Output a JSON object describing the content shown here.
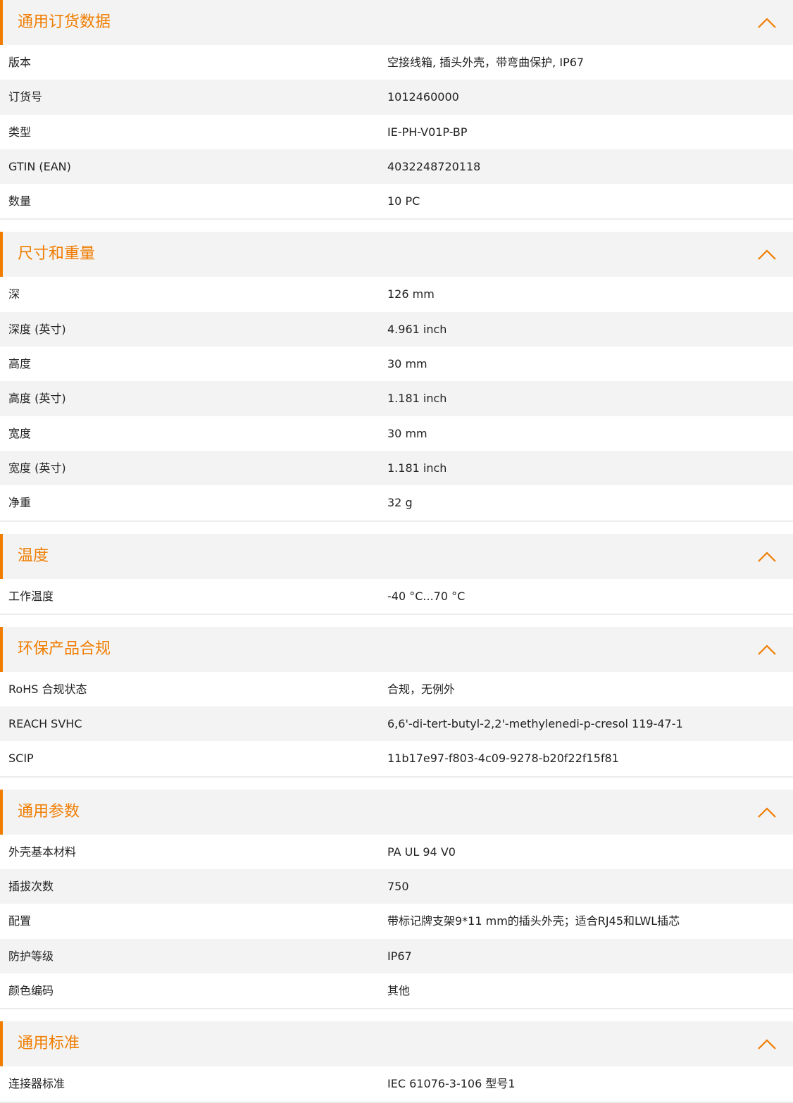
{
  "colors": {
    "accent": "#f07d00",
    "row_alt": "#f3f3f3",
    "header_bg": "#f3f3f3",
    "text": "#222222"
  },
  "icons": {
    "collapse": "chevron-up-icon"
  },
  "sections": [
    {
      "title": "通用订货数据",
      "rows": [
        {
          "label": "版本",
          "value": "空接线箱, 插头外壳，带弯曲保护, IP67"
        },
        {
          "label": "订货号",
          "value": "1012460000"
        },
        {
          "label": "类型",
          "value": "IE-PH-V01P-BP"
        },
        {
          "label": "GTIN (EAN)",
          "value": "4032248720118"
        },
        {
          "label": "数量",
          "value": "10  PC"
        }
      ]
    },
    {
      "title": "尺寸和重量",
      "rows": [
        {
          "label": "深",
          "value": "126  mm"
        },
        {
          "label": "深度 (英寸)",
          "value": "4.961  inch"
        },
        {
          "label": "高度",
          "value": "30  mm"
        },
        {
          "label": "高度 (英寸)",
          "value": "1.181  inch"
        },
        {
          "label": "宽度",
          "value": "30  mm"
        },
        {
          "label": "宽度 (英寸)",
          "value": "1.181  inch"
        },
        {
          "label": "净重",
          "value": "32  g"
        }
      ]
    },
    {
      "title": "温度",
      "rows": [
        {
          "label": "工作温度",
          "value": "-40 °C...70 °C"
        }
      ]
    },
    {
      "title": "环保产品合规",
      "rows": [
        {
          "label": "RoHS 合规状态",
          "value": "合规，无例外"
        },
        {
          "label": "REACH SVHC",
          "value": "6,6'-di-tert-butyl-2,2'-methylenedi-p-cresol 119-47-1"
        },
        {
          "label": "SCIP",
          "value": "11b17e97-f803-4c09-9278-b20f22f15f81"
        }
      ]
    },
    {
      "title": "通用参数",
      "rows": [
        {
          "label": "外壳基本材料",
          "value": "PA UL 94 V0"
        },
        {
          "label": "插拔次数",
          "value": "750"
        },
        {
          "label": "配置",
          "value": "带标记牌支架9*11 mm的插头外壳；适合RJ45和LWL插芯"
        },
        {
          "label": "防护等级",
          "value": "IP67"
        },
        {
          "label": "颜色编码",
          "value": "其他"
        }
      ]
    },
    {
      "title": "通用标准",
      "rows": [
        {
          "label": "连接器标准",
          "value": "IEC 61076-3-106 型号1"
        }
      ]
    }
  ]
}
